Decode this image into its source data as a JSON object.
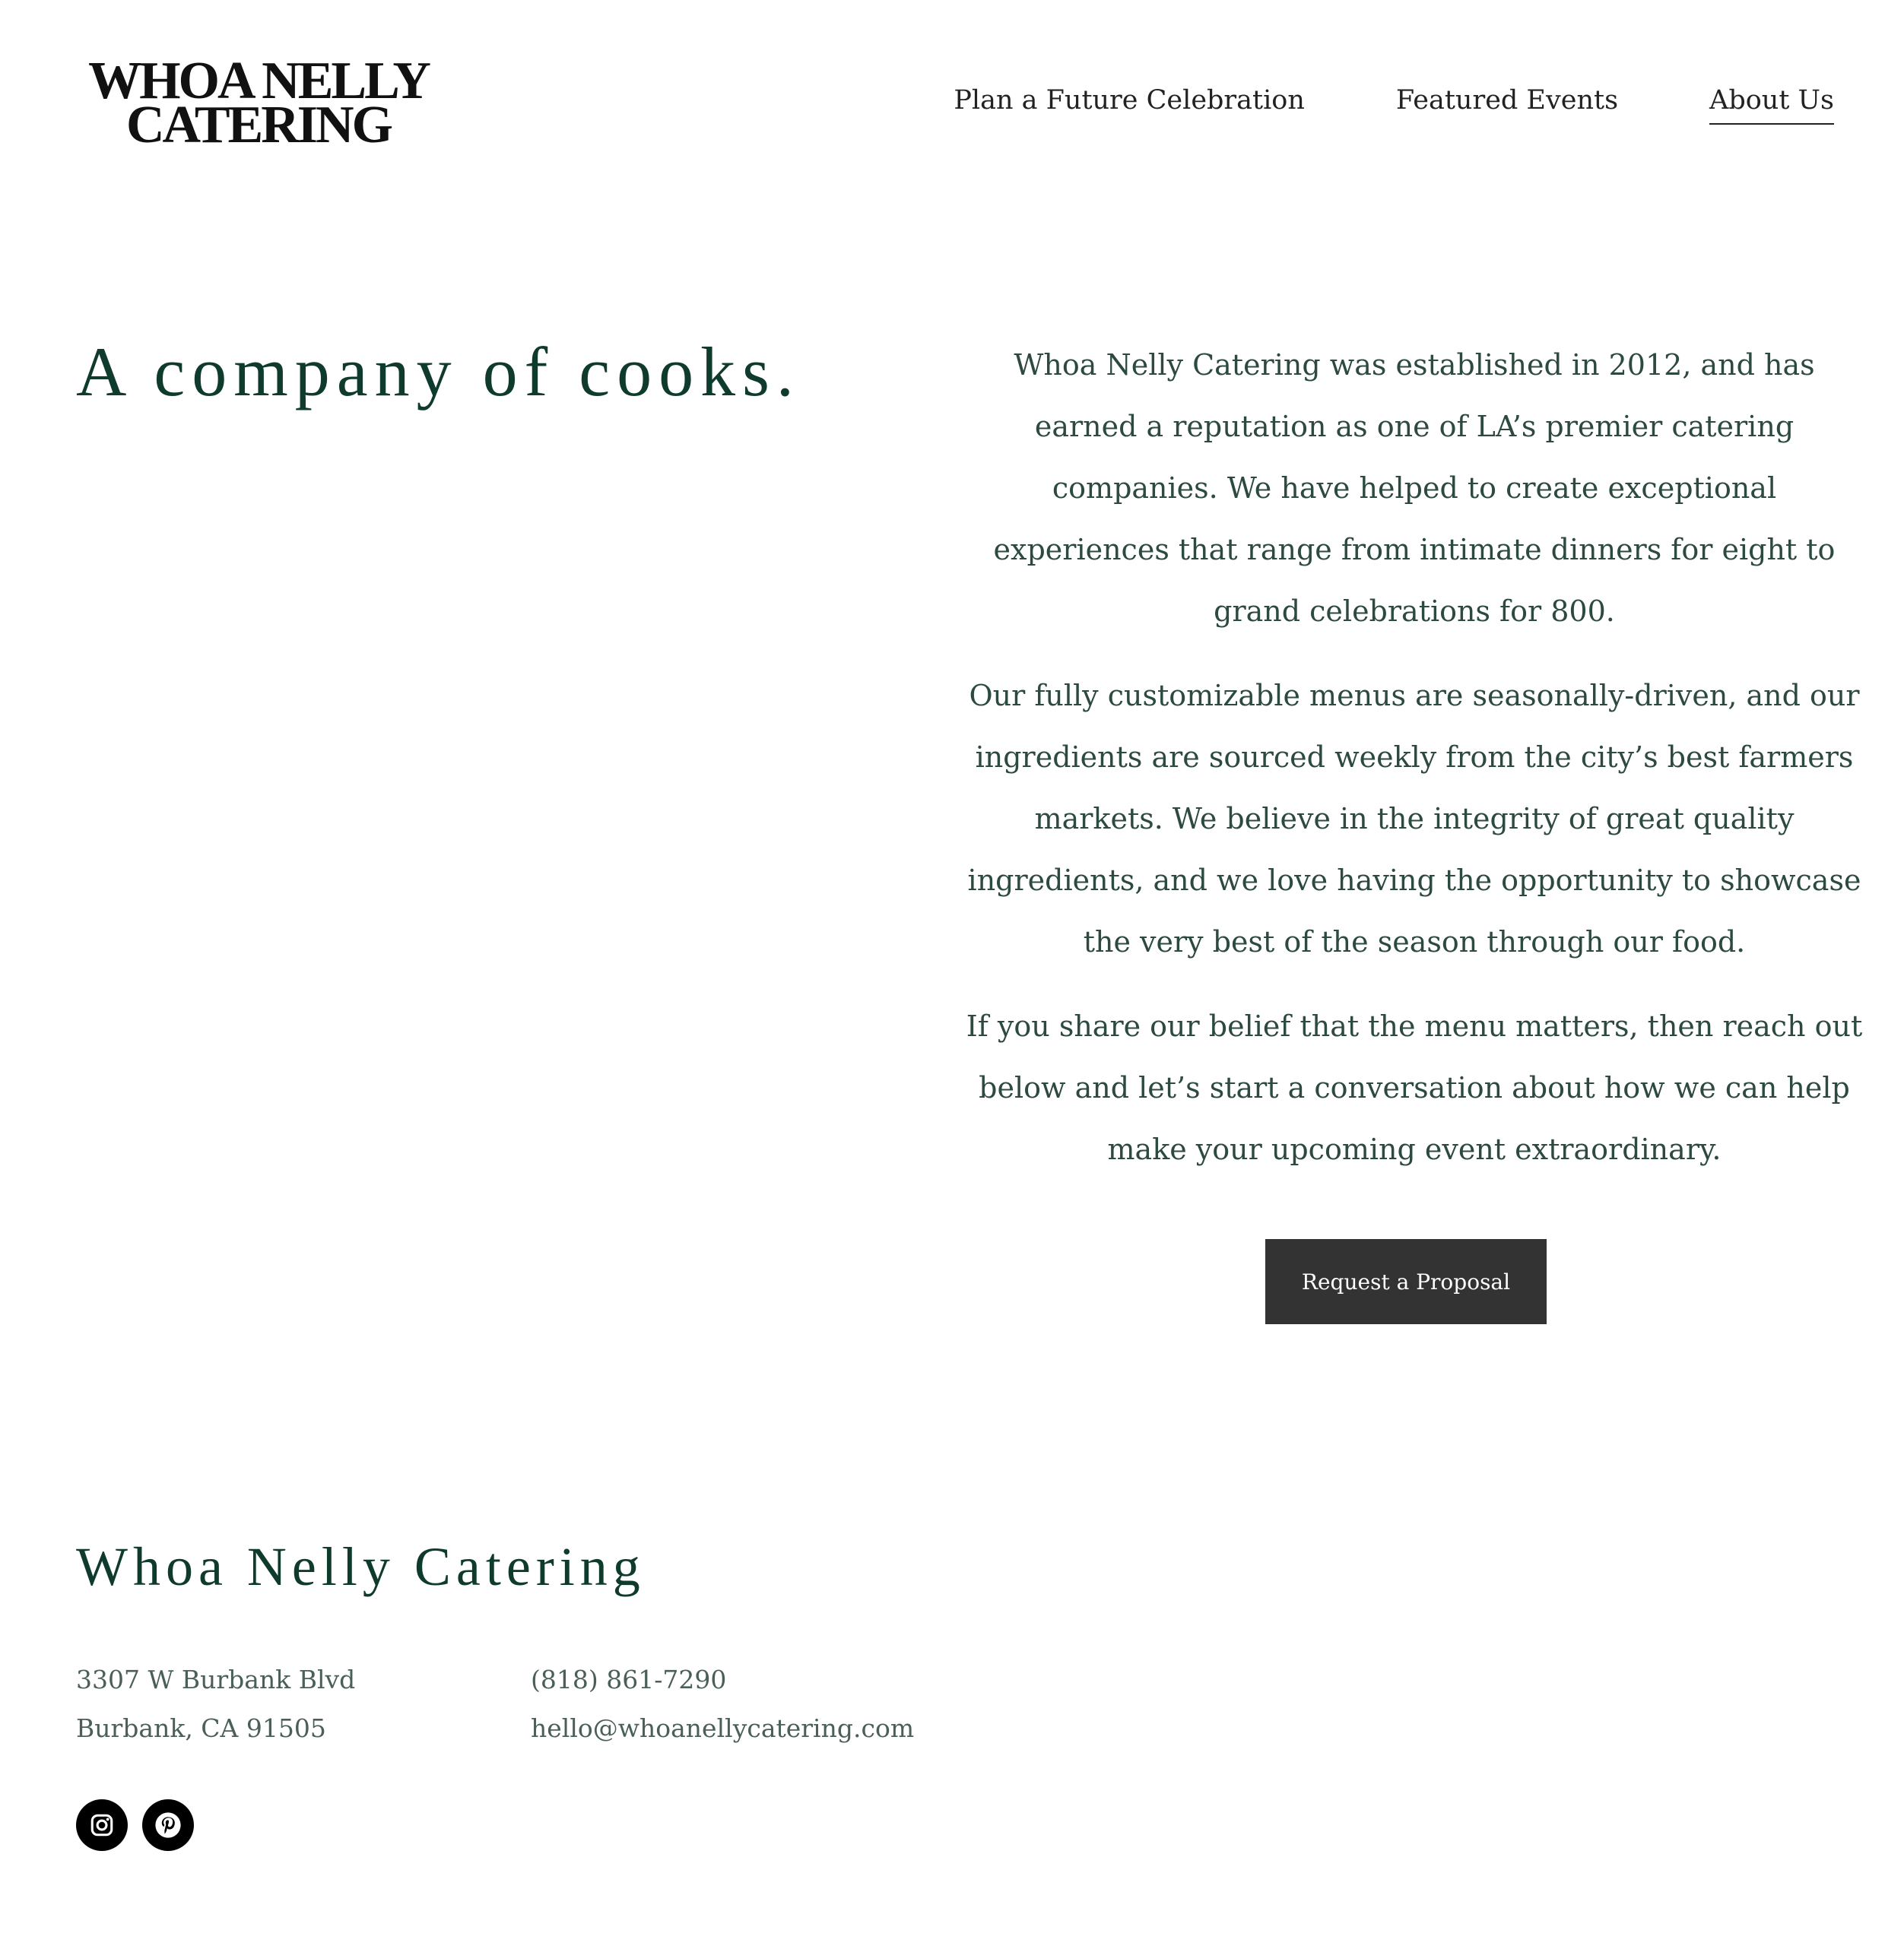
{
  "header": {
    "logo_line1": "WHOA NELLY",
    "logo_line2": "CATERING",
    "nav": [
      {
        "label": "Plan a Future Celebration"
      },
      {
        "label": "Featured Events"
      },
      {
        "label": "About Us",
        "active": true
      }
    ]
  },
  "main": {
    "headline": "A company of cooks.",
    "paragraphs": [
      "Whoa Nelly Catering was established in 2012, and has earned a reputation as one of LA’s premier catering companies. We have helped to create exceptional experiences that range from intimate dinners for eight to grand celebrations for 800.",
      "Our fully customizable menus are seasonally-driven, and our ingredients are sourced weekly from the city’s best farmers markets. We believe in the integrity of great quality ingredients, and we love having the opportunity to showcase the very best of the season through our food.",
      "If you share our belief that the menu matters, then reach out below and let’s start a conversation about how we can help make your upcoming event extraordinary."
    ],
    "cta_label": "Request a Proposal"
  },
  "footer": {
    "brand": "Whoa Nelly Catering",
    "address_line1": "3307 W Burbank Blvd",
    "address_line2": "Burbank, CA 91505",
    "phone": "(818) 861-7290",
    "email": "hello@whoanellycatering.com",
    "social": [
      {
        "icon": "instagram-icon"
      },
      {
        "icon": "pinterest-icon"
      }
    ]
  },
  "colors": {
    "headline_green": "#0e3b2e",
    "body_text": "#2d4a40",
    "button_bg": "#333333",
    "button_text": "#ffffff",
    "social_bg": "#000000"
  }
}
